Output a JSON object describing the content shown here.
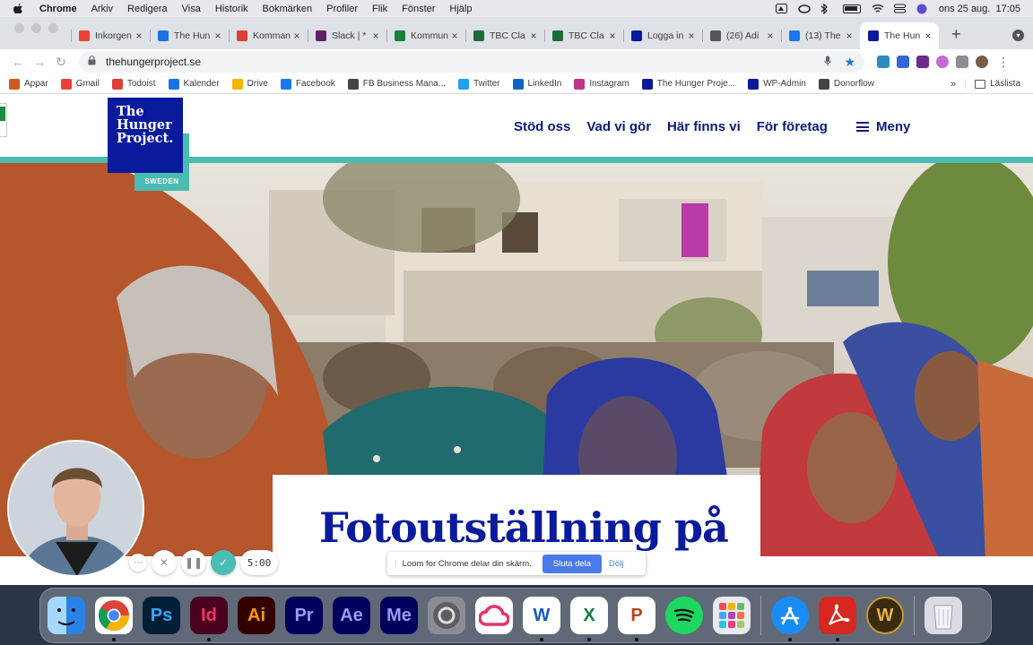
{
  "menubar": {
    "app": "Chrome",
    "items": [
      "Arkiv",
      "Redigera",
      "Visa",
      "Historik",
      "Bokmärken",
      "Profiler",
      "Flik",
      "Fönster",
      "Hjälp"
    ],
    "datetime": "ons 25 aug.  17:05"
  },
  "tabs": [
    {
      "label": "Inkorgen",
      "icon": "gmail-icon",
      "color": "#ea4335"
    },
    {
      "label": "The Hun",
      "icon": "calendar-icon",
      "color": "#1a73e8"
    },
    {
      "label": "Komman",
      "icon": "todoist-icon",
      "color": "#db4035"
    },
    {
      "label": "Slack | *",
      "icon": "slack-icon",
      "color": "#611f69"
    },
    {
      "label": "Kommun",
      "icon": "sheets-icon",
      "color": "#188038"
    },
    {
      "label": "TBC Cla",
      "icon": "tbc-icon",
      "color": "#1e6b3a"
    },
    {
      "label": "TBC Cla",
      "icon": "tbc-icon",
      "color": "#1e6b3a"
    },
    {
      "label": "Logga in",
      "icon": "thp-icon",
      "color": "#0a1a9c"
    },
    {
      "label": "(26) Adi",
      "icon": "adobe-icon",
      "color": "#555555"
    },
    {
      "label": "(13) The",
      "icon": "facebook-icon",
      "color": "#1877f2"
    },
    {
      "label": "The Hun",
      "icon": "thp-icon",
      "color": "#0a1a9c",
      "active": true
    }
  ],
  "omnibox": {
    "url": "thehungerproject.se"
  },
  "bookmarks": [
    {
      "label": "Appar",
      "icon": "apps-grid-icon",
      "color": "#d05a1c"
    },
    {
      "label": "Gmail",
      "icon": "gmail-icon",
      "color": "#ea4335"
    },
    {
      "label": "Todoist",
      "icon": "todoist-icon",
      "color": "#db4035"
    },
    {
      "label": "Kalender",
      "icon": "calendar-icon",
      "color": "#1a73e8"
    },
    {
      "label": "Drive",
      "icon": "drive-icon",
      "color": "#f4b400"
    },
    {
      "label": "Facebook",
      "icon": "facebook-icon",
      "color": "#1877f2"
    },
    {
      "label": "FB Business Mana...",
      "icon": "fb-business-icon",
      "color": "#444444"
    },
    {
      "label": "Twitter",
      "icon": "twitter-icon",
      "color": "#1da1f2"
    },
    {
      "label": "LinkedIn",
      "icon": "linkedin-icon",
      "color": "#0a66c2"
    },
    {
      "label": "Instagram",
      "icon": "instagram-icon",
      "color": "#c13584"
    },
    {
      "label": "The Hunger Proje...",
      "icon": "thp-icon",
      "color": "#0a1a9c"
    },
    {
      "label": "WP-Admin",
      "icon": "thp-icon",
      "color": "#0a1a9c"
    },
    {
      "label": "Donorflow",
      "icon": "donorflow-icon",
      "color": "#444444"
    }
  ],
  "bookmarks_more": "»",
  "reading_list": "Läslista",
  "site": {
    "logo_lines": [
      "The",
      "Hunger",
      "Project."
    ],
    "logo_sub": "SWEDEN",
    "nav": [
      "Stöd oss",
      "Vad vi gör",
      "Här finns vi",
      "För företag"
    ],
    "menu_label": "Meny",
    "hero_title": "Fotoutställning på",
    "brand_color": "#0a1a9c",
    "accent_color": "#4bbcb1"
  },
  "loom": {
    "timer": "5:00",
    "message": "Loom for Chrome delar din skärm.",
    "stop_label": "Sluta dela",
    "hide_label": "Dölj"
  },
  "dock": [
    {
      "name": "finder",
      "label": "",
      "bg": "#3fa0f0",
      "fg": "#fff",
      "running": true
    },
    {
      "name": "chrome",
      "label": "",
      "bg": "#ffffff",
      "fg": "#fff",
      "running": true
    },
    {
      "name": "photoshop",
      "label": "Ps",
      "bg": "#001e36",
      "fg": "#31a8ff",
      "running": false
    },
    {
      "name": "indesign",
      "label": "Id",
      "bg": "#49021f",
      "fg": "#ff3366",
      "running": true
    },
    {
      "name": "illustrator",
      "label": "Ai",
      "bg": "#330000",
      "fg": "#ff9a00",
      "running": false
    },
    {
      "name": "premiere",
      "label": "Pr",
      "bg": "#00005b",
      "fg": "#9999ff",
      "running": false
    },
    {
      "name": "after-effects",
      "label": "Ae",
      "bg": "#00005b",
      "fg": "#9999ff",
      "running": false
    },
    {
      "name": "media-encoder",
      "label": "Me",
      "bg": "#00005b",
      "fg": "#9999ff",
      "running": false
    },
    {
      "name": "system-preferences",
      "label": "",
      "bg": "#8a8d92",
      "fg": "#fff",
      "running": false
    },
    {
      "name": "creative-cloud",
      "label": "",
      "bg": "#ffffff",
      "fg": "#e3346a",
      "running": false
    },
    {
      "name": "word",
      "label": "W",
      "bg": "#ffffff",
      "fg": "#185abd",
      "running": true
    },
    {
      "name": "excel",
      "label": "X",
      "bg": "#ffffff",
      "fg": "#107c41",
      "running": true
    },
    {
      "name": "powerpoint",
      "label": "P",
      "bg": "#ffffff",
      "fg": "#c43e1c",
      "running": true
    },
    {
      "name": "spotify",
      "label": "",
      "bg": "#1ed760",
      "fg": "#000",
      "running": false
    },
    {
      "name": "launchpad",
      "label": "",
      "bg": "#e8e8ee",
      "fg": "#fff",
      "running": false
    },
    {
      "name": "app-store",
      "label": "",
      "bg": "#1a8cf5",
      "fg": "#fff",
      "running": true
    },
    {
      "name": "acrobat",
      "label": "",
      "bg": "#d7281f",
      "fg": "#fff",
      "running": true
    },
    {
      "name": "world-of-warcraft",
      "label": "W",
      "bg": "#3a2a10",
      "fg": "#e8b43a",
      "running": false
    },
    {
      "name": "trash",
      "label": "",
      "bg": "#d9dde3",
      "fg": "#fff",
      "running": false
    }
  ]
}
